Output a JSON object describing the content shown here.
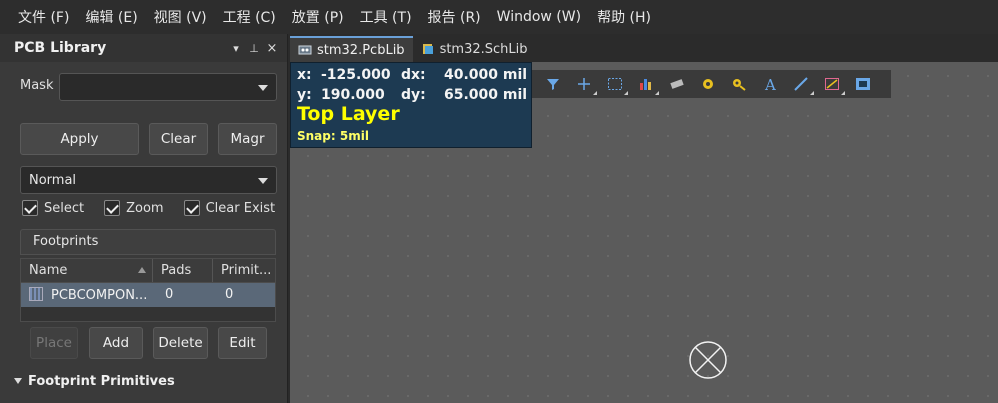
{
  "menu": [
    "文件 (F)",
    "编辑 (E)",
    "视图 (V)",
    "工程 (C)",
    "放置 (P)",
    "工具 (T)",
    "报告 (R)",
    "Window (W)",
    "帮助 (H)"
  ],
  "panel": {
    "title": "PCB Library",
    "controls": [
      "▾",
      "⊥",
      "×"
    ],
    "mask_label": "Mask",
    "mask_value": "",
    "buttons": {
      "apply": "Apply",
      "clear": "Clear",
      "magnify": "Magr"
    },
    "mode": "Normal",
    "checks": {
      "select": "Select",
      "zoom": "Zoom",
      "clear_existing": "Clear Exist"
    },
    "footprints_header": "Footprints",
    "columns": [
      "Name",
      "Pads",
      "Primit..."
    ],
    "rows": [
      {
        "name": "PCBCOMPON...",
        "pads": "0",
        "primitives": "0"
      }
    ],
    "actions": {
      "place": "Place",
      "add": "Add",
      "delete": "Delete",
      "edit": "Edit"
    },
    "primitives_header": "Footprint Primitives"
  },
  "tabs": [
    {
      "label": "stm32.PcbLib",
      "active": true,
      "icon": "pcb-icon"
    },
    {
      "label": "stm32.SchLib",
      "active": false,
      "icon": "sch-icon"
    }
  ],
  "hud": {
    "x_label": "x:",
    "x": "-125.000",
    "dx_label": "dx:",
    "dx": "40.000 mil",
    "y_label": "y:",
    "y": "190.000",
    "dy_label": "dy:",
    "dy": "65.000 mil",
    "layer": "Top Layer",
    "snap": "Snap: 5mil"
  },
  "toolbar_icons": [
    "filter-icon",
    "crosshair-icon",
    "select-rect-icon",
    "chart-icon",
    "component-icon",
    "pad-icon",
    "via-icon",
    "text-icon",
    "line-icon",
    "region-icon",
    "board-icon"
  ],
  "colors": {
    "hud_bg": "#1d3a52",
    "layer_text": "#ffff00",
    "canvas": "#5b5b5b",
    "selected_row": "#5a6878"
  }
}
